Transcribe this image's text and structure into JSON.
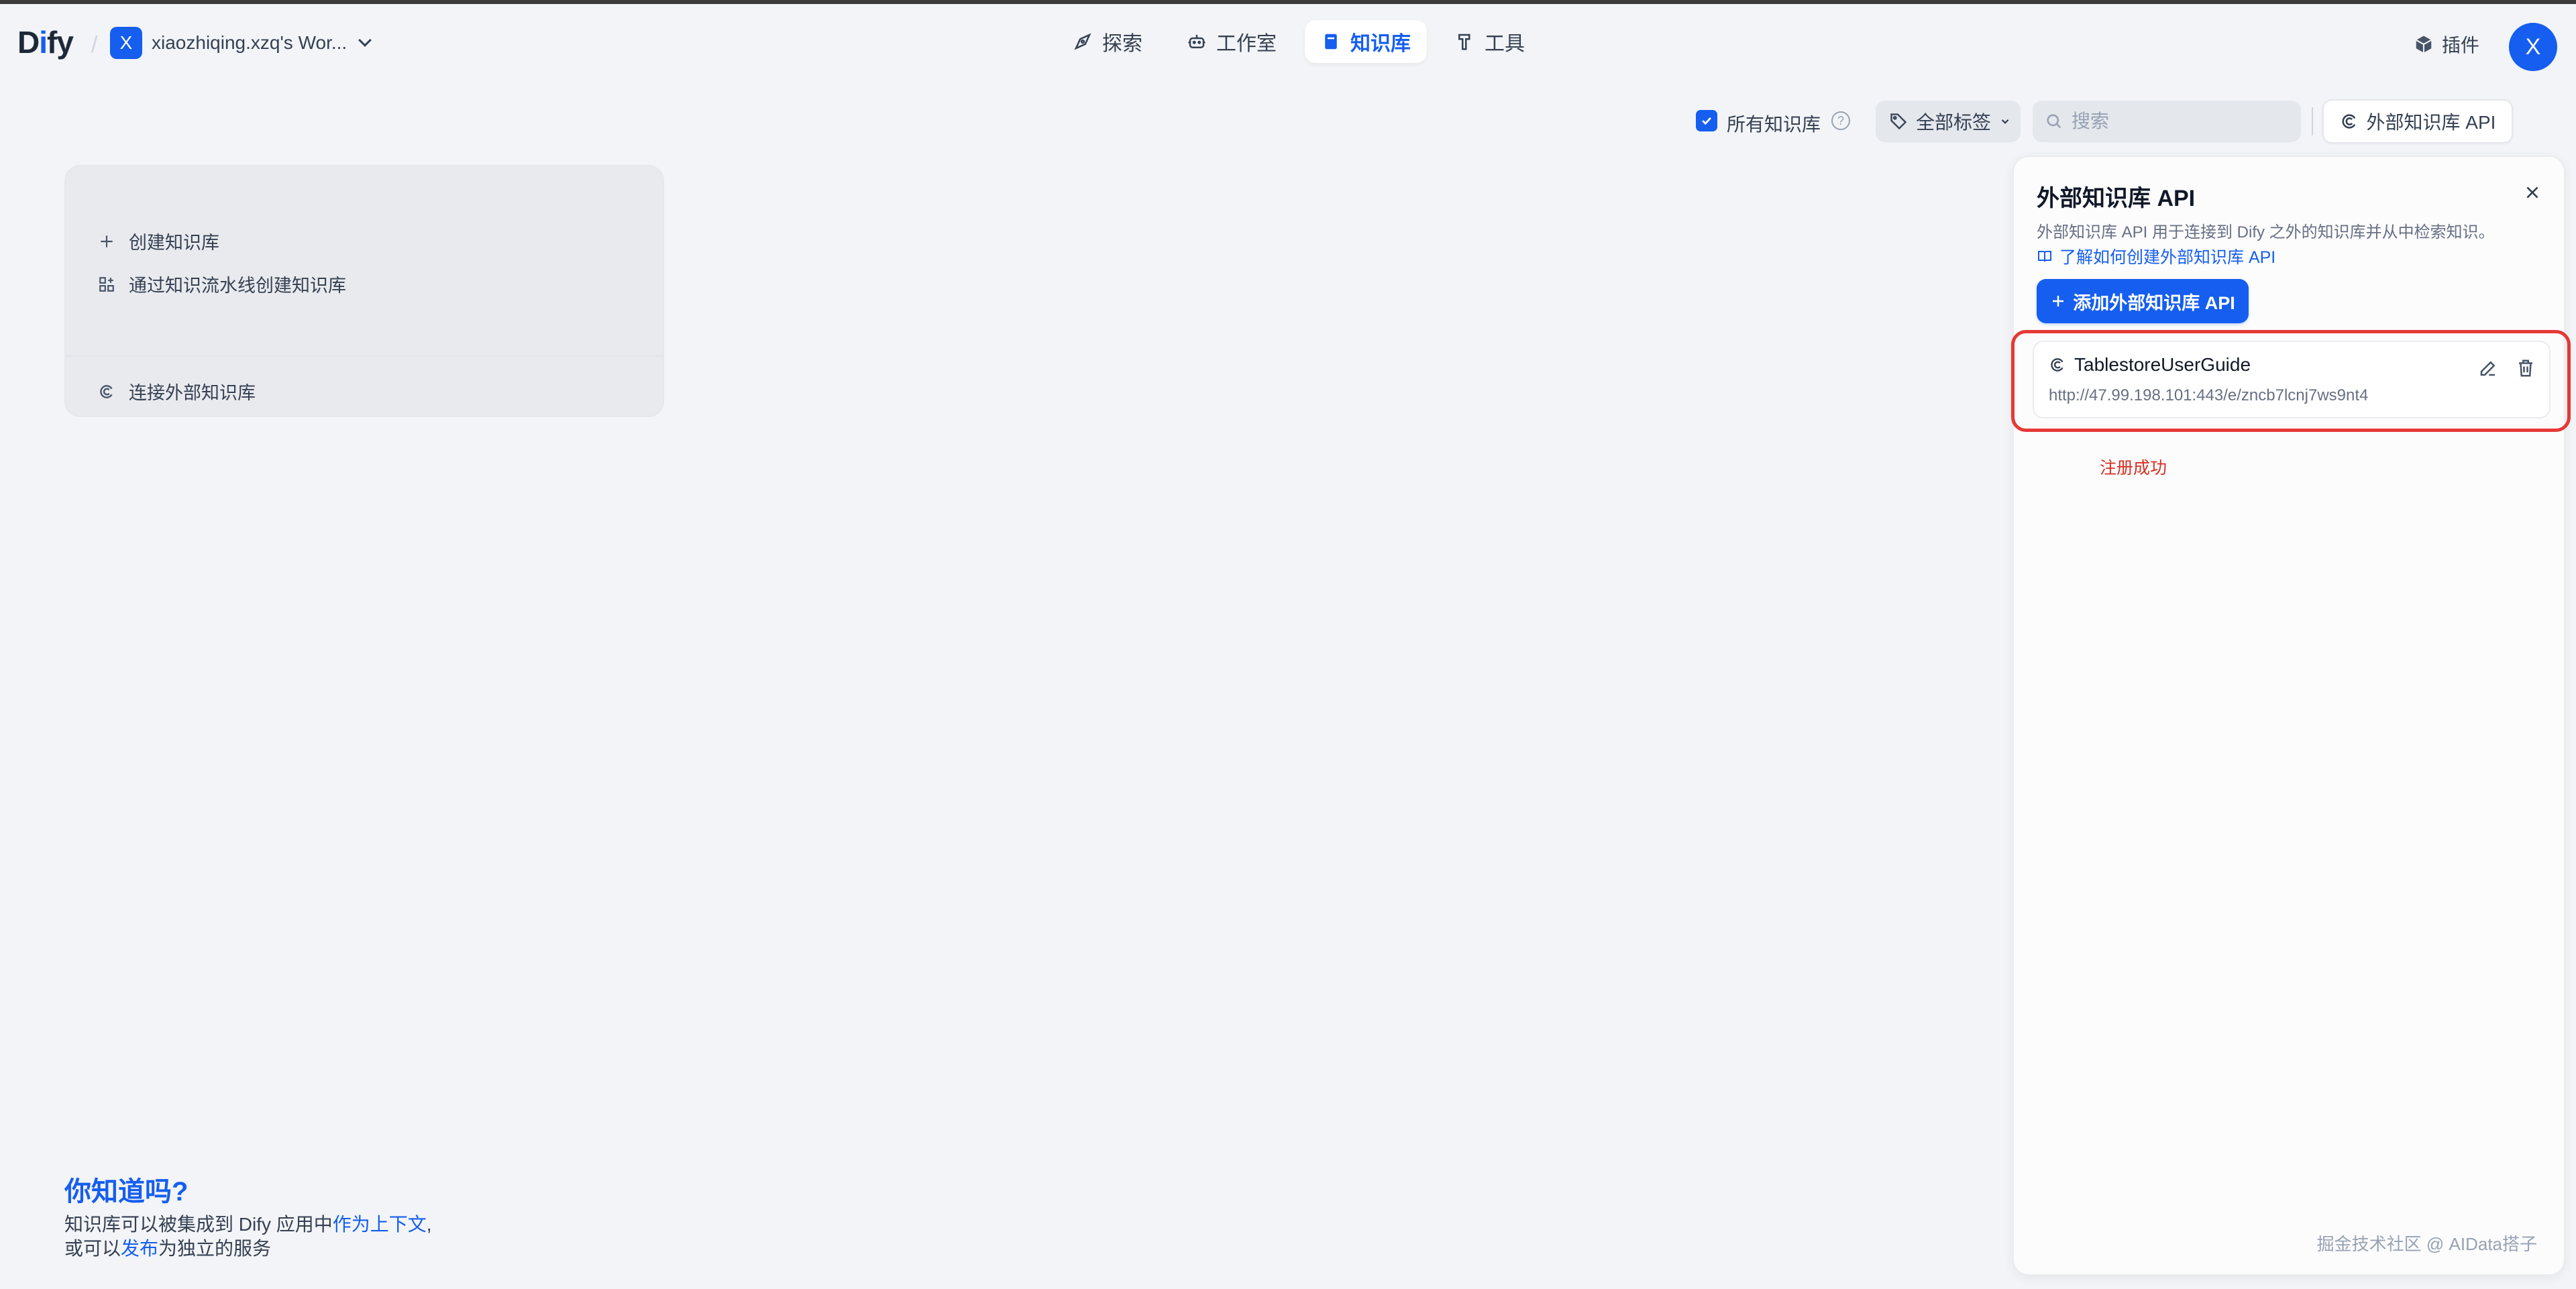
{
  "app": {
    "logo_text_d": "D",
    "logo_text_i": "i",
    "logo_text_fy": "fy",
    "workspace_initial": "X",
    "workspace_name": "xiaozhiqing.xzq's Wor...",
    "user_initial": "X"
  },
  "nav": {
    "explore": "探索",
    "studio": "工作室",
    "knowledge": "知识库",
    "tools": "工具",
    "plugins": "插件"
  },
  "filters": {
    "all_knowledge_label": "所有知识库",
    "all_knowledge_checked": true,
    "tags_label": "全部标签",
    "search_placeholder": "搜索",
    "external_api_button": "外部知识库 API"
  },
  "create_card": {
    "create_label": "创建知识库",
    "pipeline_label": "通过知识流水线创建知识库",
    "connect_external_label": "连接外部知识库"
  },
  "did_you_know": {
    "title": "你知道吗?",
    "line1_prefix": "知识库可以被集成到 Dify 应用中",
    "line1_link": "作为上下文",
    "line1_suffix": ",",
    "line2_prefix": "或可以",
    "line2_link": "发布",
    "line2_suffix": "为独立的服务"
  },
  "panel": {
    "title": "外部知识库 API",
    "description": "外部知识库 API 用于连接到 Dify 之外的知识库并从中检索知识。",
    "learn_link": "了解如何创建外部知识库 API",
    "add_button": "添加外部知识库 API",
    "api_items": [
      {
        "name": "TablestoreUserGuide",
        "url": "http://47.99.198.101:443/e/zncb7lcnj7ws9nt4"
      }
    ],
    "annotation": "注册成功",
    "footnote": "掘金技术社区 @ AIData搭子"
  },
  "colors": {
    "accent": "#155eef",
    "background": "#f2f4f7",
    "highlight_border": "#e53935",
    "annotation_text": "#d92d20"
  }
}
